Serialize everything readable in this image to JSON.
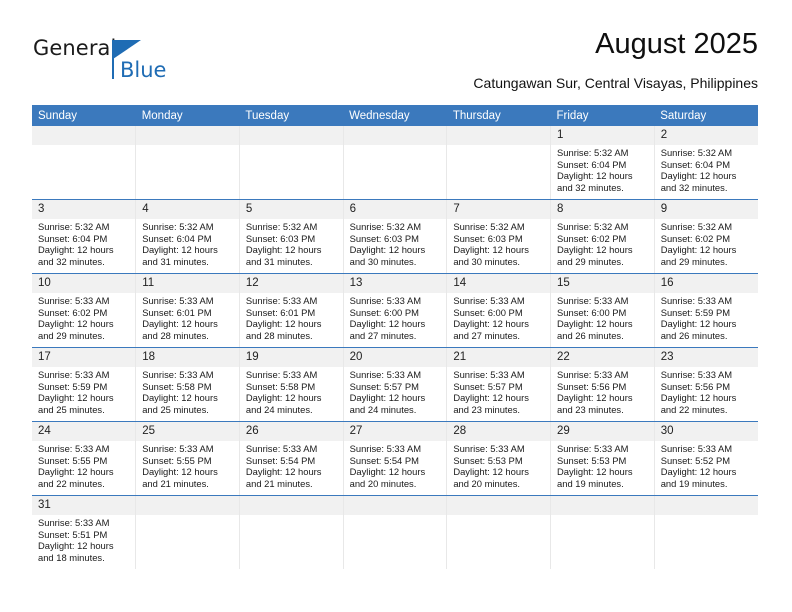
{
  "brand": {
    "name_part1": "General",
    "name_part2": "Blue",
    "triangle_color": "#1f6cb4"
  },
  "header": {
    "title": "August 2025",
    "subtitle": "Catungawan Sur, Central Visayas, Philippines",
    "header_bg_color": "#3b79bd",
    "daynum_bg_color": "#f1f1f1"
  },
  "weekdays": [
    "Sunday",
    "Monday",
    "Tuesday",
    "Wednesday",
    "Thursday",
    "Friday",
    "Saturday"
  ],
  "weeks": [
    [
      {
        "day": "",
        "blank": true,
        "sunrise": "",
        "sunset": "",
        "daylight1": "",
        "daylight2": ""
      },
      {
        "day": "",
        "blank": true,
        "sunrise": "",
        "sunset": "",
        "daylight1": "",
        "daylight2": ""
      },
      {
        "day": "",
        "blank": true,
        "sunrise": "",
        "sunset": "",
        "daylight1": "",
        "daylight2": ""
      },
      {
        "day": "",
        "blank": true,
        "sunrise": "",
        "sunset": "",
        "daylight1": "",
        "daylight2": ""
      },
      {
        "day": "",
        "blank": true,
        "sunrise": "",
        "sunset": "",
        "daylight1": "",
        "daylight2": ""
      },
      {
        "day": "1",
        "blank": false,
        "sunrise": "Sunrise: 5:32 AM",
        "sunset": "Sunset: 6:04 PM",
        "daylight1": "Daylight: 12 hours",
        "daylight2": "and 32 minutes."
      },
      {
        "day": "2",
        "blank": false,
        "sunrise": "Sunrise: 5:32 AM",
        "sunset": "Sunset: 6:04 PM",
        "daylight1": "Daylight: 12 hours",
        "daylight2": "and 32 minutes."
      }
    ],
    [
      {
        "day": "3",
        "blank": false,
        "sunrise": "Sunrise: 5:32 AM",
        "sunset": "Sunset: 6:04 PM",
        "daylight1": "Daylight: 12 hours",
        "daylight2": "and 32 minutes."
      },
      {
        "day": "4",
        "blank": false,
        "sunrise": "Sunrise: 5:32 AM",
        "sunset": "Sunset: 6:04 PM",
        "daylight1": "Daylight: 12 hours",
        "daylight2": "and 31 minutes."
      },
      {
        "day": "5",
        "blank": false,
        "sunrise": "Sunrise: 5:32 AM",
        "sunset": "Sunset: 6:03 PM",
        "daylight1": "Daylight: 12 hours",
        "daylight2": "and 31 minutes."
      },
      {
        "day": "6",
        "blank": false,
        "sunrise": "Sunrise: 5:32 AM",
        "sunset": "Sunset: 6:03 PM",
        "daylight1": "Daylight: 12 hours",
        "daylight2": "and 30 minutes."
      },
      {
        "day": "7",
        "blank": false,
        "sunrise": "Sunrise: 5:32 AM",
        "sunset": "Sunset: 6:03 PM",
        "daylight1": "Daylight: 12 hours",
        "daylight2": "and 30 minutes."
      },
      {
        "day": "8",
        "blank": false,
        "sunrise": "Sunrise: 5:32 AM",
        "sunset": "Sunset: 6:02 PM",
        "daylight1": "Daylight: 12 hours",
        "daylight2": "and 29 minutes."
      },
      {
        "day": "9",
        "blank": false,
        "sunrise": "Sunrise: 5:32 AM",
        "sunset": "Sunset: 6:02 PM",
        "daylight1": "Daylight: 12 hours",
        "daylight2": "and 29 minutes."
      }
    ],
    [
      {
        "day": "10",
        "blank": false,
        "sunrise": "Sunrise: 5:33 AM",
        "sunset": "Sunset: 6:02 PM",
        "daylight1": "Daylight: 12 hours",
        "daylight2": "and 29 minutes."
      },
      {
        "day": "11",
        "blank": false,
        "sunrise": "Sunrise: 5:33 AM",
        "sunset": "Sunset: 6:01 PM",
        "daylight1": "Daylight: 12 hours",
        "daylight2": "and 28 minutes."
      },
      {
        "day": "12",
        "blank": false,
        "sunrise": "Sunrise: 5:33 AM",
        "sunset": "Sunset: 6:01 PM",
        "daylight1": "Daylight: 12 hours",
        "daylight2": "and 28 minutes."
      },
      {
        "day": "13",
        "blank": false,
        "sunrise": "Sunrise: 5:33 AM",
        "sunset": "Sunset: 6:00 PM",
        "daylight1": "Daylight: 12 hours",
        "daylight2": "and 27 minutes."
      },
      {
        "day": "14",
        "blank": false,
        "sunrise": "Sunrise: 5:33 AM",
        "sunset": "Sunset: 6:00 PM",
        "daylight1": "Daylight: 12 hours",
        "daylight2": "and 27 minutes."
      },
      {
        "day": "15",
        "blank": false,
        "sunrise": "Sunrise: 5:33 AM",
        "sunset": "Sunset: 6:00 PM",
        "daylight1": "Daylight: 12 hours",
        "daylight2": "and 26 minutes."
      },
      {
        "day": "16",
        "blank": false,
        "sunrise": "Sunrise: 5:33 AM",
        "sunset": "Sunset: 5:59 PM",
        "daylight1": "Daylight: 12 hours",
        "daylight2": "and 26 minutes."
      }
    ],
    [
      {
        "day": "17",
        "blank": false,
        "sunrise": "Sunrise: 5:33 AM",
        "sunset": "Sunset: 5:59 PM",
        "daylight1": "Daylight: 12 hours",
        "daylight2": "and 25 minutes."
      },
      {
        "day": "18",
        "blank": false,
        "sunrise": "Sunrise: 5:33 AM",
        "sunset": "Sunset: 5:58 PM",
        "daylight1": "Daylight: 12 hours",
        "daylight2": "and 25 minutes."
      },
      {
        "day": "19",
        "blank": false,
        "sunrise": "Sunrise: 5:33 AM",
        "sunset": "Sunset: 5:58 PM",
        "daylight1": "Daylight: 12 hours",
        "daylight2": "and 24 minutes."
      },
      {
        "day": "20",
        "blank": false,
        "sunrise": "Sunrise: 5:33 AM",
        "sunset": "Sunset: 5:57 PM",
        "daylight1": "Daylight: 12 hours",
        "daylight2": "and 24 minutes."
      },
      {
        "day": "21",
        "blank": false,
        "sunrise": "Sunrise: 5:33 AM",
        "sunset": "Sunset: 5:57 PM",
        "daylight1": "Daylight: 12 hours",
        "daylight2": "and 23 minutes."
      },
      {
        "day": "22",
        "blank": false,
        "sunrise": "Sunrise: 5:33 AM",
        "sunset": "Sunset: 5:56 PM",
        "daylight1": "Daylight: 12 hours",
        "daylight2": "and 23 minutes."
      },
      {
        "day": "23",
        "blank": false,
        "sunrise": "Sunrise: 5:33 AM",
        "sunset": "Sunset: 5:56 PM",
        "daylight1": "Daylight: 12 hours",
        "daylight2": "and 22 minutes."
      }
    ],
    [
      {
        "day": "24",
        "blank": false,
        "sunrise": "Sunrise: 5:33 AM",
        "sunset": "Sunset: 5:55 PM",
        "daylight1": "Daylight: 12 hours",
        "daylight2": "and 22 minutes."
      },
      {
        "day": "25",
        "blank": false,
        "sunrise": "Sunrise: 5:33 AM",
        "sunset": "Sunset: 5:55 PM",
        "daylight1": "Daylight: 12 hours",
        "daylight2": "and 21 minutes."
      },
      {
        "day": "26",
        "blank": false,
        "sunrise": "Sunrise: 5:33 AM",
        "sunset": "Sunset: 5:54 PM",
        "daylight1": "Daylight: 12 hours",
        "daylight2": "and 21 minutes."
      },
      {
        "day": "27",
        "blank": false,
        "sunrise": "Sunrise: 5:33 AM",
        "sunset": "Sunset: 5:54 PM",
        "daylight1": "Daylight: 12 hours",
        "daylight2": "and 20 minutes."
      },
      {
        "day": "28",
        "blank": false,
        "sunrise": "Sunrise: 5:33 AM",
        "sunset": "Sunset: 5:53 PM",
        "daylight1": "Daylight: 12 hours",
        "daylight2": "and 20 minutes."
      },
      {
        "day": "29",
        "blank": false,
        "sunrise": "Sunrise: 5:33 AM",
        "sunset": "Sunset: 5:53 PM",
        "daylight1": "Daylight: 12 hours",
        "daylight2": "and 19 minutes."
      },
      {
        "day": "30",
        "blank": false,
        "sunrise": "Sunrise: 5:33 AM",
        "sunset": "Sunset: 5:52 PM",
        "daylight1": "Daylight: 12 hours",
        "daylight2": "and 19 minutes."
      }
    ],
    [
      {
        "day": "31",
        "blank": false,
        "sunrise": "Sunrise: 5:33 AM",
        "sunset": "Sunset: 5:51 PM",
        "daylight1": "Daylight: 12 hours",
        "daylight2": "and 18 minutes."
      },
      {
        "day": "",
        "blank": true,
        "sunrise": "",
        "sunset": "",
        "daylight1": "",
        "daylight2": ""
      },
      {
        "day": "",
        "blank": true,
        "sunrise": "",
        "sunset": "",
        "daylight1": "",
        "daylight2": ""
      },
      {
        "day": "",
        "blank": true,
        "sunrise": "",
        "sunset": "",
        "daylight1": "",
        "daylight2": ""
      },
      {
        "day": "",
        "blank": true,
        "sunrise": "",
        "sunset": "",
        "daylight1": "",
        "daylight2": ""
      },
      {
        "day": "",
        "blank": true,
        "sunrise": "",
        "sunset": "",
        "daylight1": "",
        "daylight2": ""
      },
      {
        "day": "",
        "blank": true,
        "sunrise": "",
        "sunset": "",
        "daylight1": "",
        "daylight2": ""
      }
    ]
  ]
}
